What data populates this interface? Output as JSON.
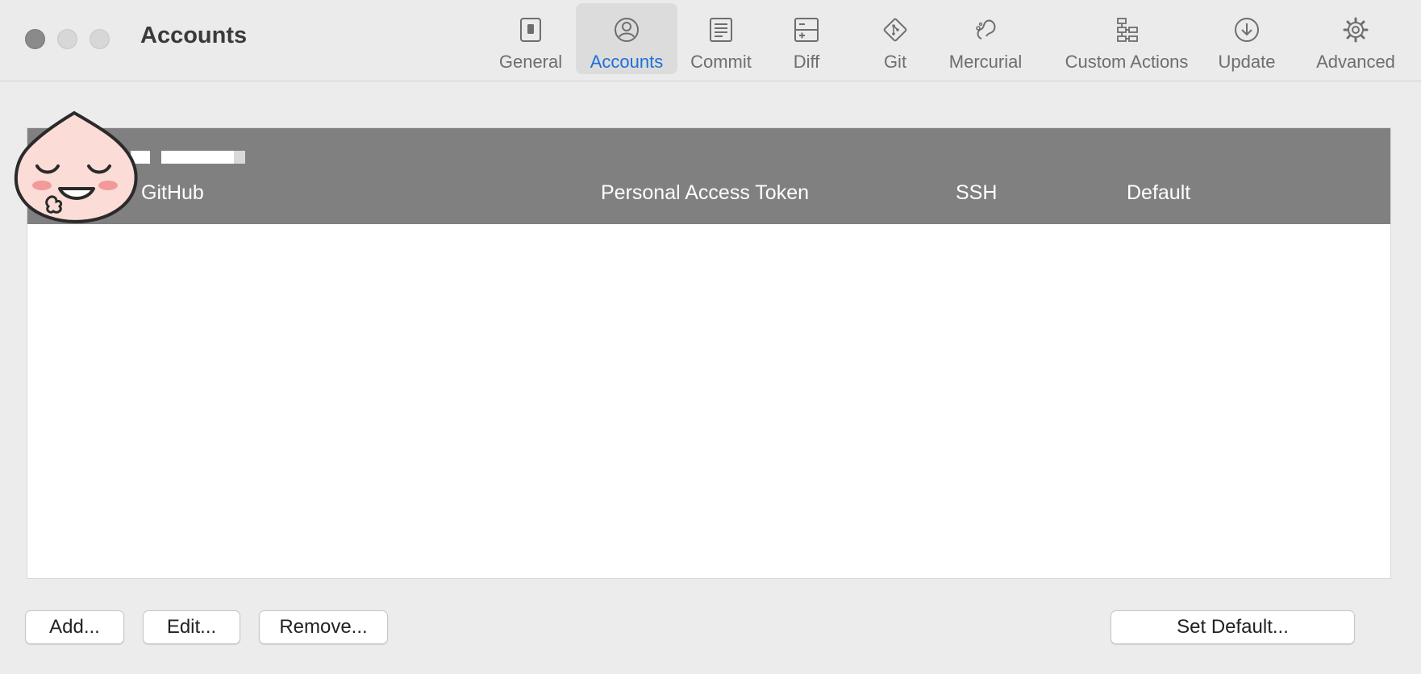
{
  "window": {
    "title": "Accounts"
  },
  "toolbar": {
    "tabs": [
      {
        "label": "General",
        "icon": "switch-icon",
        "active": false
      },
      {
        "label": "Accounts",
        "icon": "user-circle-icon",
        "active": true
      },
      {
        "label": "Commit",
        "icon": "document-lines-icon",
        "active": false
      },
      {
        "label": "Diff",
        "icon": "diff-icon",
        "active": false
      },
      {
        "label": "Git",
        "icon": "git-icon",
        "active": false
      },
      {
        "label": "Mercurial",
        "icon": "mercurial-icon",
        "active": false
      },
      {
        "label": "Custom Actions",
        "icon": "flowchart-icon",
        "active": false
      },
      {
        "label": "Update",
        "icon": "download-circle-icon",
        "active": false
      },
      {
        "label": "Advanced",
        "icon": "gear-icon",
        "active": false
      }
    ],
    "accent_color": "#1e6fd9"
  },
  "table": {
    "columns": [
      "GitHub",
      "Personal Access Token",
      "SSH",
      "Default"
    ],
    "rows": []
  },
  "buttons": {
    "add": "Add...",
    "edit": "Edit...",
    "remove": "Remove...",
    "set_default": "Set Default..."
  }
}
